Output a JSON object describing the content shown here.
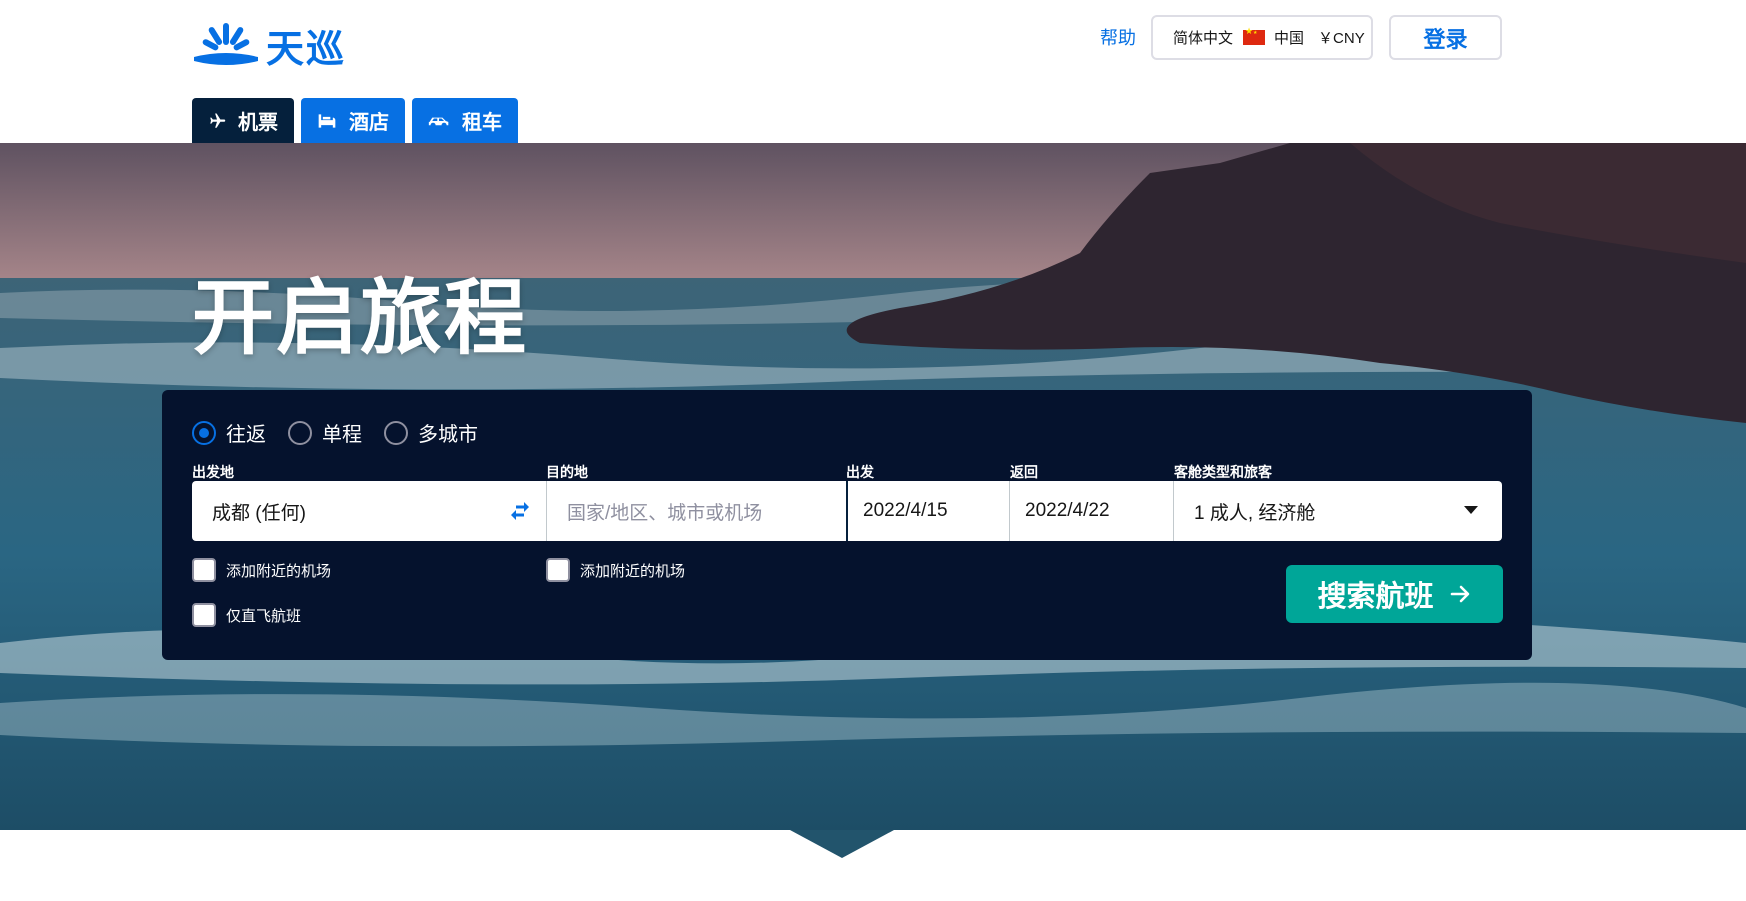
{
  "brand": {
    "name": "天巡",
    "color": "#0770e3"
  },
  "header": {
    "help_label": "帮助",
    "locale": {
      "language": "简体中文",
      "country": "中国",
      "currency": "￥CNY"
    },
    "login_label": "登录"
  },
  "tabs": [
    {
      "label": "机票",
      "icon": "plane-icon",
      "active": true
    },
    {
      "label": "酒店",
      "icon": "bed-icon",
      "active": false
    },
    {
      "label": "租车",
      "icon": "car-icon",
      "active": false
    }
  ],
  "hero": {
    "title": "开启旅程"
  },
  "search": {
    "trip_types": [
      {
        "label": "往返",
        "checked": true
      },
      {
        "label": "单程",
        "checked": false
      },
      {
        "label": "多城市",
        "checked": false
      }
    ],
    "origin": {
      "label": "出发地",
      "value": "成都 (任何)"
    },
    "destination": {
      "label": "目的地",
      "placeholder": "国家/地区、城市或机场"
    },
    "depart": {
      "label": "出发",
      "value": "2022/4/15"
    },
    "return": {
      "label": "返回",
      "value": "2022/4/22"
    },
    "cabin": {
      "label": "客舱类型和旅客",
      "value": "1 成人, 经济舱"
    },
    "origin_nearby_label": "添加附近的机场",
    "dest_nearby_label": "添加附近的机场",
    "direct_only_label": "仅直飞航班",
    "submit_label": "搜索航班"
  },
  "colors": {
    "panel": "#05122d",
    "active_tab": "#05203c",
    "search_button": "#00a698"
  }
}
